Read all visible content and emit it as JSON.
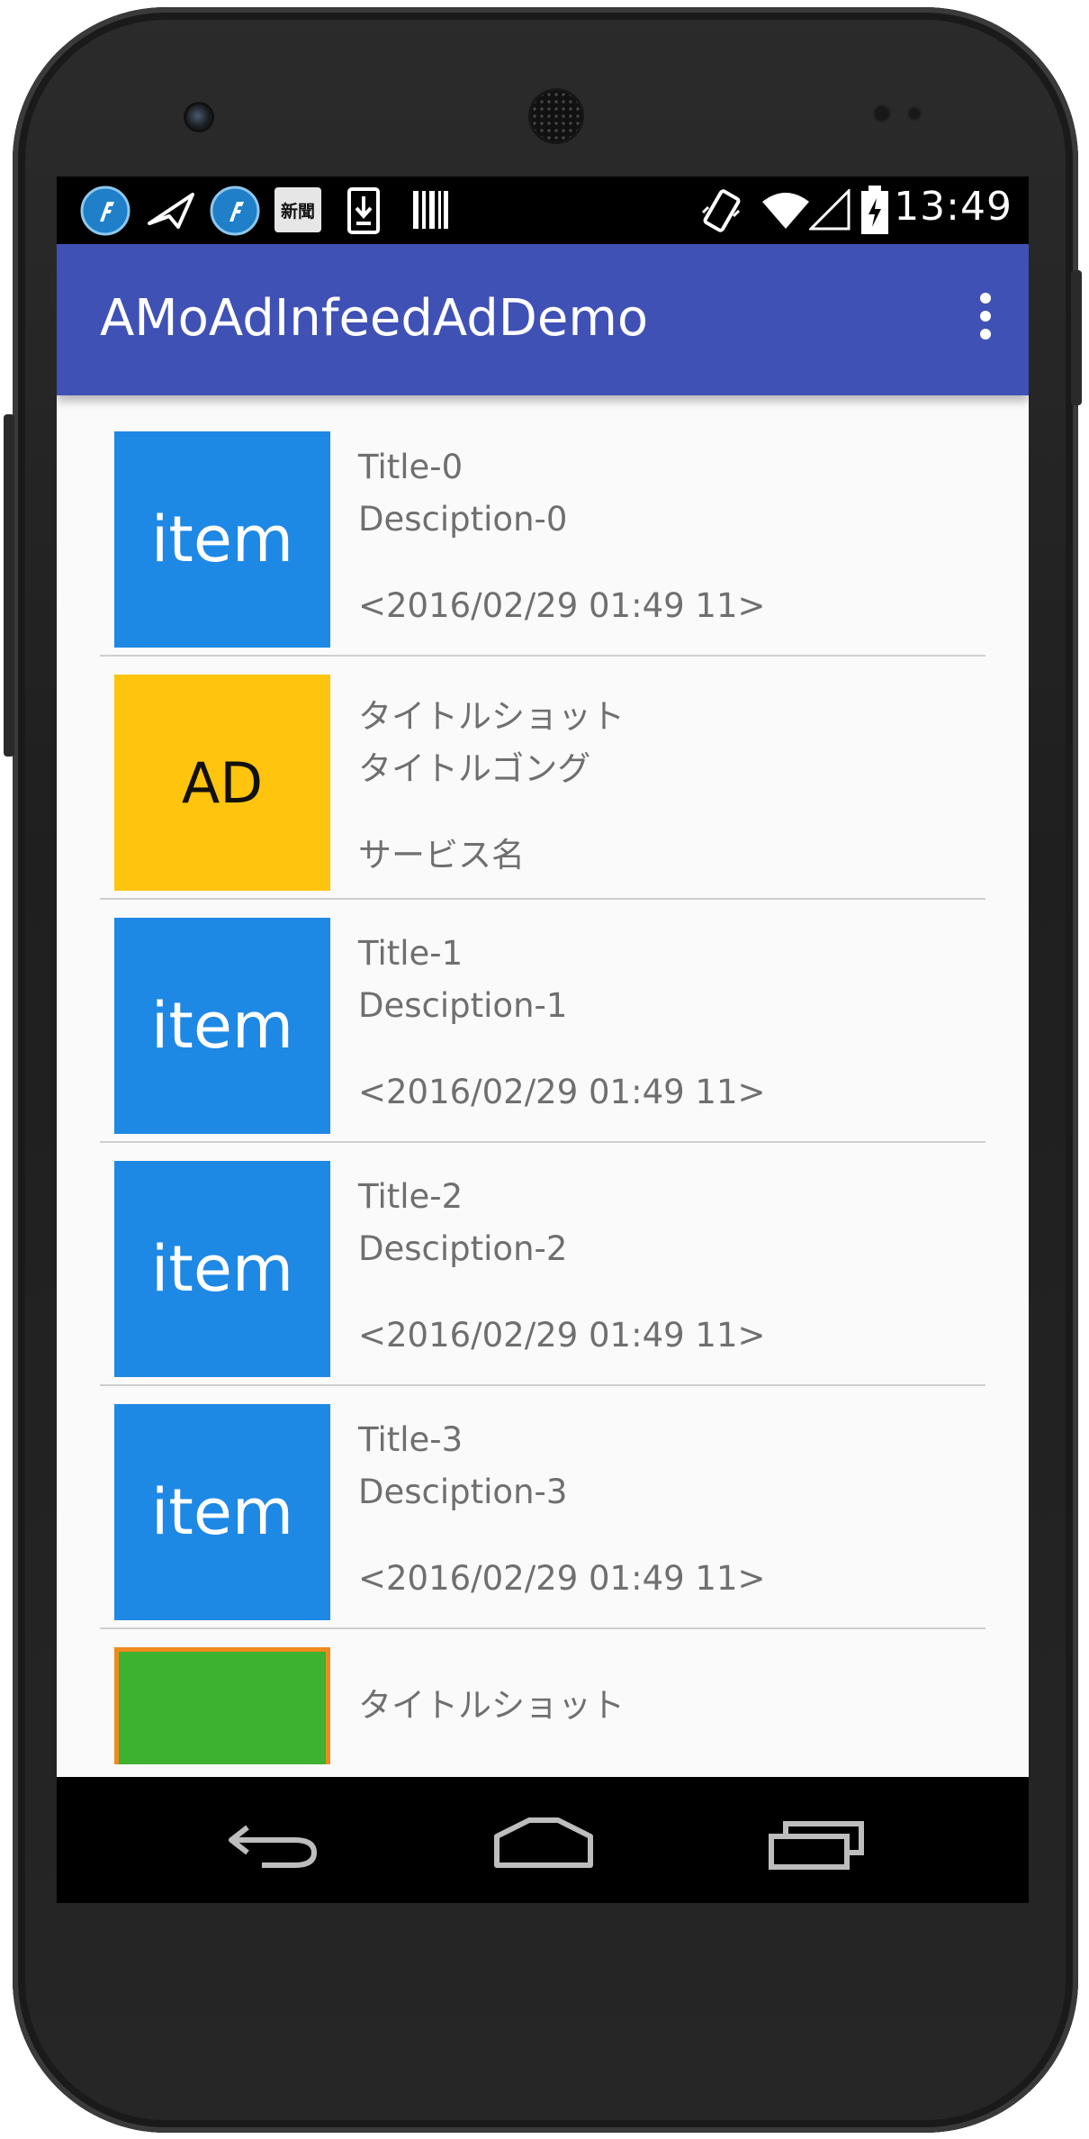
{
  "status_bar": {
    "time": "13:49",
    "left_icons": [
      "feedly-icon",
      "send-icon",
      "feedly-icon",
      "newspaper-icon",
      "download-icon",
      "barcode-icon"
    ],
    "right_icons": [
      "vibrate-icon",
      "wifi-icon",
      "signal-icon",
      "battery-charging-icon"
    ],
    "newspaper_glyph": "新聞"
  },
  "app_bar": {
    "title": "AMoAdInfeedAdDemo",
    "menu_icon": "overflow-menu-icon",
    "color": "#3f51b5"
  },
  "list": {
    "items": [
      {
        "type": "item",
        "thumb_label": "item",
        "line1": "Title-0",
        "line2": "Desciption-0",
        "line3": "<2016/02/29 01:49 11>"
      },
      {
        "type": "ad",
        "thumb_label": "AD",
        "line1": "タイトルショット",
        "line2": "タイトルゴング",
        "line3": "サービス名"
      },
      {
        "type": "item",
        "thumb_label": "item",
        "line1": "Title-1",
        "line2": "Desciption-1",
        "line3": "<2016/02/29 01:49 11>"
      },
      {
        "type": "item",
        "thumb_label": "item",
        "line1": "Title-2",
        "line2": "Desciption-2",
        "line3": "<2016/02/29 01:49 11>"
      },
      {
        "type": "item",
        "thumb_label": "item",
        "line1": "Title-3",
        "line2": "Desciption-3",
        "line3": "<2016/02/29 01:49 11>"
      },
      {
        "type": "ad-partial",
        "thumb_label": "",
        "line1": "タイトルショット",
        "line2": "",
        "line3": ""
      }
    ],
    "colors": {
      "item_thumb": "#1e88e5",
      "ad_thumb": "#ffc40d",
      "ad_partial_thumb": "#3db130",
      "ad_partial_border": "#f08a1e"
    }
  },
  "nav_bar": {
    "back_icon": "back-icon",
    "home_icon": "home-icon",
    "recents_icon": "recents-icon"
  }
}
